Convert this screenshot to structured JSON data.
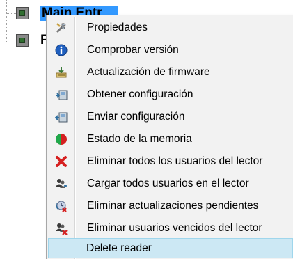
{
  "tree": {
    "nodes": [
      {
        "label": "Main Entr",
        "selected": true,
        "icon": "device-icon"
      },
      {
        "label": "F",
        "selected": false,
        "icon": "device-icon"
      }
    ]
  },
  "context_menu": {
    "highlight_color": "#cce8f4",
    "items": [
      {
        "label": "Propiedades",
        "icon": "tools-icon"
      },
      {
        "label": "Comprobar versión",
        "icon": "info-icon"
      },
      {
        "label": "Actualización de firmware",
        "icon": "firmware-update-icon"
      },
      {
        "label": "Obtener configuración",
        "icon": "get-config-icon"
      },
      {
        "label": "Enviar configuración",
        "icon": "send-config-icon"
      },
      {
        "label": "Estado de la memoria",
        "icon": "memory-pie-icon"
      },
      {
        "label": "Eliminar todos los usuarios del lector",
        "icon": "red-x-icon"
      },
      {
        "label": "Cargar todos usuarios en el lector",
        "icon": "users-load-icon"
      },
      {
        "label": "Eliminar actualizaciones pendientes",
        "icon": "remove-pending-icon"
      },
      {
        "label": "Eliminar usuarios vencidos del lector",
        "icon": "users-remove-icon"
      },
      {
        "label": "Delete reader",
        "icon": "",
        "highlighted": true
      }
    ]
  }
}
